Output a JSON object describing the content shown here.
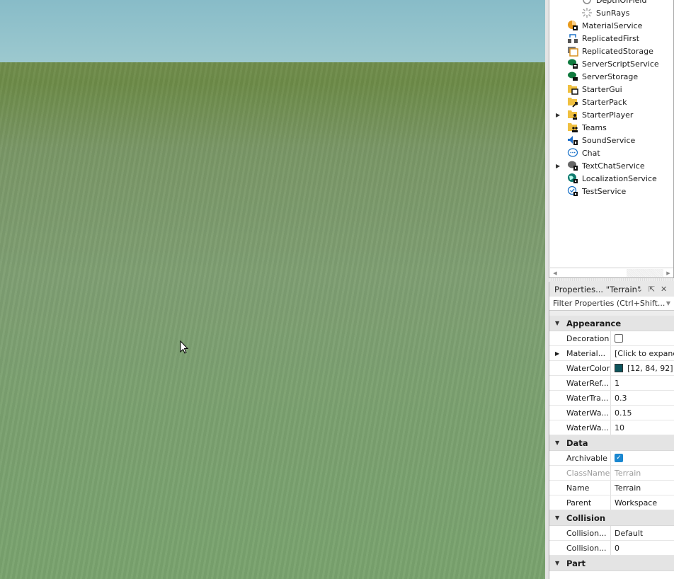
{
  "explorer": {
    "items": [
      {
        "label": "DepthOfField",
        "icon": "depth-of-field-icon",
        "indent": 2,
        "expandable": false
      },
      {
        "label": "SunRays",
        "icon": "sun-rays-icon",
        "indent": 2,
        "expandable": false
      },
      {
        "label": "MaterialService",
        "icon": "material-service-icon",
        "indent": 1,
        "expandable": false
      },
      {
        "label": "ReplicatedFirst",
        "icon": "replicated-first-icon",
        "indent": 1,
        "expandable": false
      },
      {
        "label": "ReplicatedStorage",
        "icon": "replicated-storage-icon",
        "indent": 1,
        "expandable": false
      },
      {
        "label": "ServerScriptService",
        "icon": "server-script-service-icon",
        "indent": 1,
        "expandable": false
      },
      {
        "label": "ServerStorage",
        "icon": "server-storage-icon",
        "indent": 1,
        "expandable": false
      },
      {
        "label": "StarterGui",
        "icon": "starter-gui-icon",
        "indent": 1,
        "expandable": false
      },
      {
        "label": "StarterPack",
        "icon": "starter-pack-icon",
        "indent": 1,
        "expandable": false
      },
      {
        "label": "StarterPlayer",
        "icon": "starter-player-icon",
        "indent": 1,
        "expandable": true
      },
      {
        "label": "Teams",
        "icon": "teams-icon",
        "indent": 1,
        "expandable": false
      },
      {
        "label": "SoundService",
        "icon": "sound-service-icon",
        "indent": 1,
        "expandable": false
      },
      {
        "label": "Chat",
        "icon": "chat-icon",
        "indent": 1,
        "expandable": false
      },
      {
        "label": "TextChatService",
        "icon": "text-chat-service-icon",
        "indent": 1,
        "expandable": true
      },
      {
        "label": "LocalizationService",
        "icon": "localization-service-icon",
        "indent": 1,
        "expandable": false
      },
      {
        "label": "TestService",
        "icon": "test-service-icon",
        "indent": 1,
        "expandable": false
      }
    ]
  },
  "properties": {
    "title": "Properties... \"Terrain\"",
    "filter_placeholder": "Filter Properties (Ctrl+Shift...",
    "categories": [
      {
        "name": "Appearance",
        "rows": [
          {
            "name": "Decoration",
            "value": "",
            "type": "checkbox",
            "checked": false
          },
          {
            "name": "Material...",
            "value": "[Click to expand]",
            "type": "expand"
          },
          {
            "name": "WaterColor",
            "value": "[12, 84, 92]",
            "type": "color",
            "color": "#0c545c"
          },
          {
            "name": "WaterRef...",
            "value": "1",
            "type": "text"
          },
          {
            "name": "WaterTra...",
            "value": "0.3",
            "type": "text"
          },
          {
            "name": "WaterWa...",
            "value": "0.15",
            "type": "text"
          },
          {
            "name": "WaterWa...",
            "value": "10",
            "type": "text"
          }
        ]
      },
      {
        "name": "Data",
        "rows": [
          {
            "name": "Archivable",
            "value": "",
            "type": "checkbox",
            "checked": true
          },
          {
            "name": "ClassName",
            "value": "Terrain",
            "type": "readonly"
          },
          {
            "name": "Name",
            "value": "Terrain",
            "type": "text"
          },
          {
            "name": "Parent",
            "value": "Workspace",
            "type": "text"
          }
        ]
      },
      {
        "name": "Collision",
        "rows": [
          {
            "name": "Collision...",
            "value": "Default",
            "type": "text"
          },
          {
            "name": "Collision...",
            "value": "0",
            "type": "text"
          }
        ]
      },
      {
        "name": "Part",
        "rows": []
      }
    ]
  },
  "colors": {
    "accent": "#1a87d0",
    "water": "#0c545c"
  }
}
